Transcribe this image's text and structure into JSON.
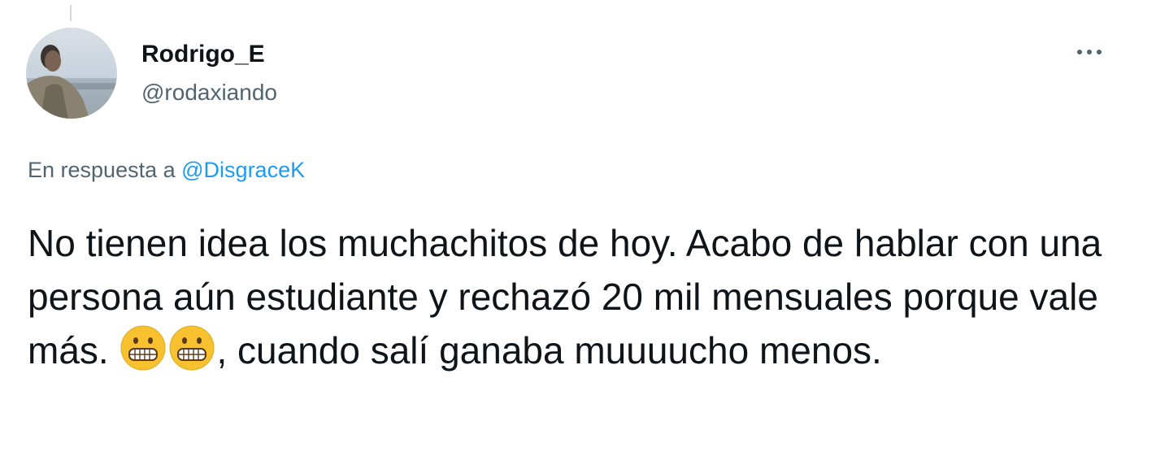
{
  "tweet": {
    "author": {
      "display_name": "Rodrigo_E",
      "handle": "@rodaxiando"
    },
    "more_icon": "more-horizontal-icon",
    "reply_context": {
      "prefix": "En respuesta a",
      "mention": "@DisgraceK"
    },
    "body": {
      "part1": "No tienen idea los muchachitos de hoy. Acabo de hablar con una persona aún estudiante y rechazó 20 mil mensuales porque vale más.",
      "emoji": "grimacing-face-emoji",
      "part2": ", cuando salí ganaba muuuucho menos."
    }
  },
  "colors": {
    "text_primary": "#0f1419",
    "text_secondary": "#536471",
    "link": "#1d9bf0",
    "emoji_yellow": "#f7c12f"
  }
}
